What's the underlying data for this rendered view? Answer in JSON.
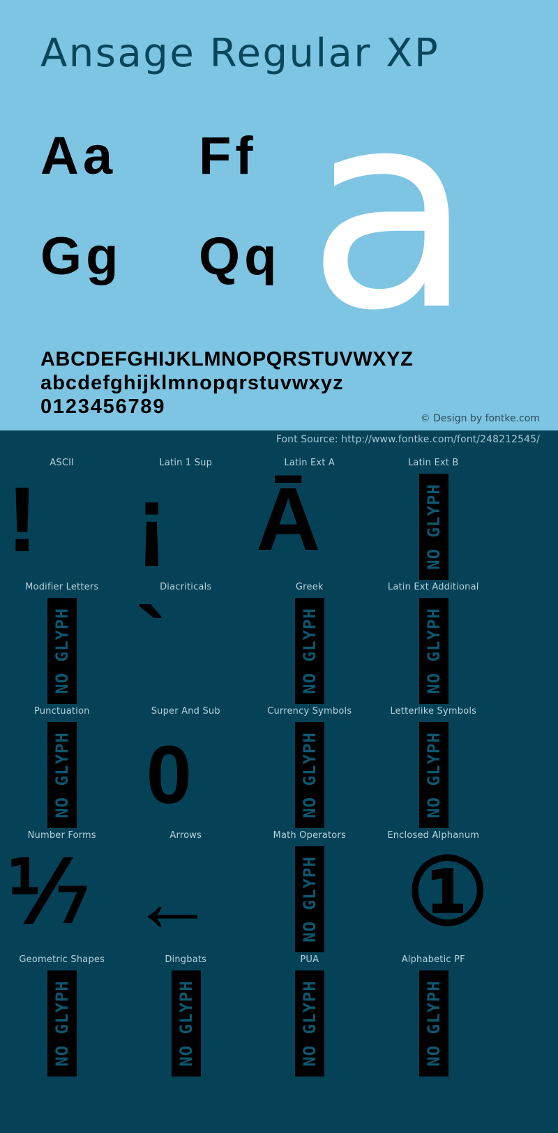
{
  "specimen": {
    "title": "Ansage Regular XP",
    "samples": {
      "pair_1": "Aa",
      "pair_2": "Ff",
      "pair_3": "Gg",
      "pair_4": "Qq",
      "feature_glyph": "a"
    },
    "alphabet": {
      "uppercase": "ABCDEFGHIJKLMNOPQRSTUVWXYZ",
      "lowercase": "abcdefghijklmnopqrstuvwxyz",
      "digits": "0123456789"
    },
    "copyright": "© Design by fontke.com",
    "font_source": "Font Source: http://www.fontke.com/font/248212545/"
  },
  "colors": {
    "light_background": "#7ec5e3",
    "dark_background": "#054257",
    "glyph_black": "#000000",
    "feature_glyph_white": "#ffffff",
    "title_teal": "#08465c",
    "label_text": "#b9d2db",
    "noglyph_fill": "#0d5771"
  },
  "coverage": {
    "no_glyph_label": "NO GLYPH",
    "rows": [
      [
        {
          "label": "ASCII",
          "glyph": "!",
          "has_glyph": true,
          "style": ""
        },
        {
          "label": "Latin 1 Sup",
          "glyph": "¡",
          "has_glyph": true,
          "style": "iexcl"
        },
        {
          "label": "Latin Ext A",
          "glyph": "Ā",
          "has_glyph": true,
          "style": "macron"
        },
        {
          "label": "Latin Ext B",
          "glyph": "",
          "has_glyph": false,
          "style": ""
        }
      ],
      [
        {
          "label": "Modifier Letters",
          "glyph": "",
          "has_glyph": false,
          "style": ""
        },
        {
          "label": "Diacriticals",
          "glyph": "`",
          "has_glyph": true,
          "style": "grave"
        },
        {
          "label": "Greek",
          "glyph": "",
          "has_glyph": false,
          "style": ""
        },
        {
          "label": "Latin Ext Additional",
          "glyph": "",
          "has_glyph": false,
          "style": ""
        }
      ],
      [
        {
          "label": "Punctuation",
          "glyph": "",
          "has_glyph": false,
          "style": ""
        },
        {
          "label": "Super And Sub",
          "glyph": "0",
          "has_glyph": true,
          "style": "zero"
        },
        {
          "label": "Currency Symbols",
          "glyph": "",
          "has_glyph": false,
          "style": ""
        },
        {
          "label": "Letterlike Symbols",
          "glyph": "",
          "has_glyph": false,
          "style": ""
        }
      ],
      [
        {
          "label": "Number Forms",
          "glyph": "⅐",
          "has_glyph": true,
          "style": "frac"
        },
        {
          "label": "Arrows",
          "glyph": "←",
          "has_glyph": true,
          "style": "arrow"
        },
        {
          "label": "Math Operators",
          "glyph": "",
          "has_glyph": false,
          "style": ""
        },
        {
          "label": "Enclosed Alphanum",
          "glyph": "①",
          "has_glyph": true,
          "style": "circled"
        }
      ],
      [
        {
          "label": "Geometric Shapes",
          "glyph": "",
          "has_glyph": false,
          "style": ""
        },
        {
          "label": "Dingbats",
          "glyph": "",
          "has_glyph": false,
          "style": ""
        },
        {
          "label": "PUA",
          "glyph": "",
          "has_glyph": false,
          "style": ""
        },
        {
          "label": "Alphabetic PF",
          "glyph": "",
          "has_glyph": false,
          "style": ""
        }
      ]
    ]
  }
}
